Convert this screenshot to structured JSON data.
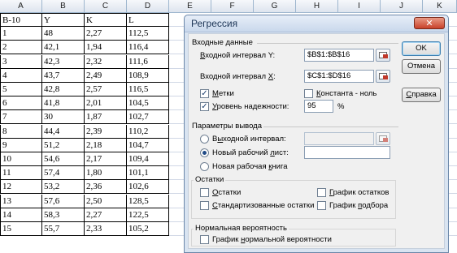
{
  "sheet": {
    "columns": [
      "A",
      "B",
      "C",
      "D",
      "E",
      "F",
      "G",
      "H",
      "I",
      "J",
      "K"
    ],
    "header_row": [
      "В-10",
      "Y",
      "K",
      "L"
    ],
    "rows": [
      [
        "1",
        "48",
        "2,27",
        "112,5"
      ],
      [
        "2",
        "42,1",
        "1,94",
        "116,4"
      ],
      [
        "3",
        "42,3",
        "2,32",
        "111,6"
      ],
      [
        "4",
        "43,7",
        "2,49",
        "108,9"
      ],
      [
        "5",
        "42,8",
        "2,57",
        "116,5"
      ],
      [
        "6",
        "41,8",
        "2,01",
        "104,5"
      ],
      [
        "7",
        "30",
        "1,87",
        "102,7"
      ],
      [
        "8",
        "44,4",
        "2,39",
        "110,2"
      ],
      [
        "9",
        "51,2",
        "2,18",
        "104,7"
      ],
      [
        "10",
        "54,6",
        "2,17",
        "109,4"
      ],
      [
        "11",
        "57,4",
        "1,80",
        "101,1"
      ],
      [
        "12",
        "53,2",
        "2,36",
        "102,6"
      ],
      [
        "13",
        "57,6",
        "2,50",
        "128,5"
      ],
      [
        "14",
        "58,3",
        "2,27",
        "122,5"
      ],
      [
        "15",
        "55,7",
        "2,33",
        "105,2"
      ]
    ]
  },
  "dialog": {
    "title": "Регрессия",
    "close_glyph": "✕",
    "input_section": "Входные данные",
    "y_range_label": "Входной интервал Y:",
    "y_range_value": "$B$1:$B$16",
    "x_range_label": "Входной интервал X:",
    "x_range_value": "$C$1:$D$16",
    "labels_label": "Метки",
    "labels_checked": true,
    "constant_label": "Константа - ноль",
    "constant_checked": false,
    "confidence_label": "Уровень надежности:",
    "confidence_checked": true,
    "confidence_value": "95",
    "percent": "%",
    "output_section": "Параметры вывода",
    "output_range_label": "Выходной интервал:",
    "new_sheet_label": "Новый рабочий лист:",
    "new_book_label": "Новая рабочая книга",
    "selected_output": "new_sheet",
    "residuals_section": "Остатки",
    "residuals_label": "Остатки",
    "std_residuals_label": "Стандартизованные остатки",
    "residual_plots_label": "График остатков",
    "line_fit_label": "График подбора",
    "normal_section": "Нормальная вероятность",
    "normal_plot_label": "График нормальной вероятности",
    "ok_label": "OK",
    "cancel_label": "Отмена",
    "help_label": "Справка",
    "check_glyph": "✓"
  }
}
